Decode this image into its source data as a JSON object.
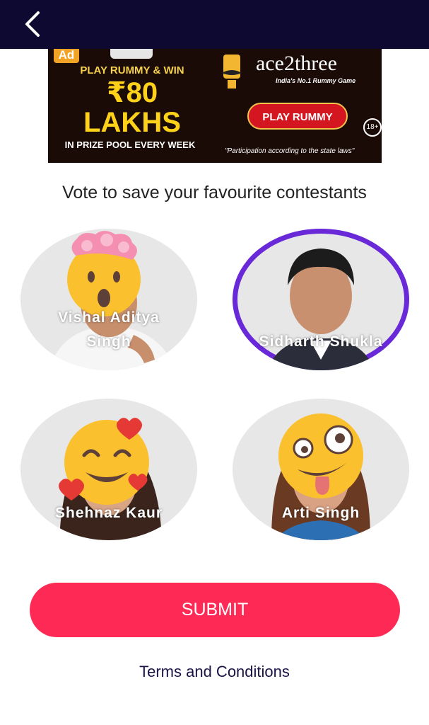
{
  "header": {
    "back_icon": "chevron-left-icon"
  },
  "ad": {
    "badge": "Ad",
    "line1": "PLAY RUMMY & WIN",
    "amount": "₹80",
    "amount_suffix": "LAKHS",
    "line3": "IN PRIZE POOL EVERY WEEK",
    "brand": "ace2three",
    "tagline": "India's No.1 Rummy Game",
    "cta": "PLAY RUMMY",
    "age": "18+",
    "disclaimer": "\"Participation according to the state laws\""
  },
  "heading": "Vote to save your favourite contestants",
  "contestants": [
    {
      "name_line1": "Vishal Aditya",
      "name_line2": "Singh",
      "selected": false,
      "emoji": "exploding-head-emoji"
    },
    {
      "name_line1": "Sidharth Shukla",
      "selected": true
    },
    {
      "name_line1": "Shehnaz Kaur",
      "selected": false,
      "emoji": "smiling-face-with-hearts-emoji"
    },
    {
      "name_line1": "Arti Singh",
      "selected": false,
      "emoji": "zany-face-emoji"
    }
  ],
  "submit_label": "SUBMIT",
  "terms_label": "Terms and Conditions",
  "colors": {
    "topbar": "#0e0930",
    "accent": "#fe2a55",
    "selected_ring": "#6a29d8"
  }
}
